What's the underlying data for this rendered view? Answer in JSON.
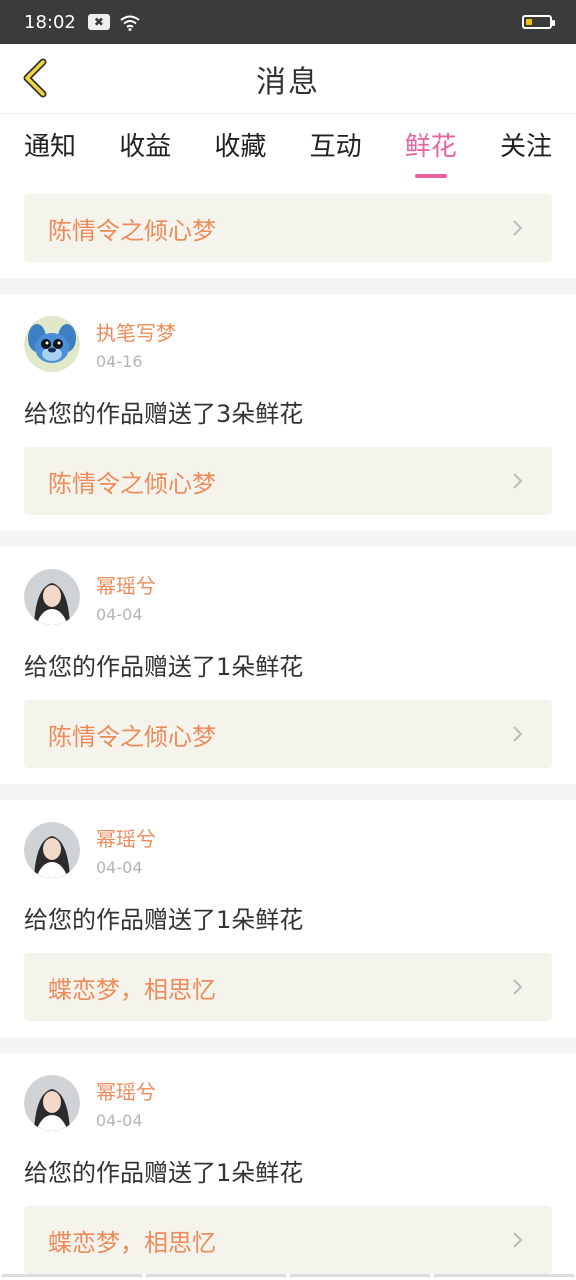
{
  "status_bar": {
    "time": "18:02"
  },
  "header": {
    "title": "消息"
  },
  "tabs": [
    {
      "label": "通知"
    },
    {
      "label": "收益"
    },
    {
      "label": "收藏"
    },
    {
      "label": "互动"
    },
    {
      "label": "鲜花",
      "active": true
    },
    {
      "label": "关注"
    }
  ],
  "first_work": {
    "name": "陈情令之倾心梦"
  },
  "messages": [
    {
      "user": "执笔写梦",
      "date": "04-16",
      "text": "给您的作品赠送了3朵鲜花",
      "work": "陈情令之倾心梦",
      "avatar": "cartoon-avatar"
    },
    {
      "user": "幂瑶兮",
      "date": "04-04",
      "text": "给您的作品赠送了1朵鲜花",
      "work": "陈情令之倾心梦",
      "avatar": "photo-avatar"
    },
    {
      "user": "幂瑶兮",
      "date": "04-04",
      "text": "给您的作品赠送了1朵鲜花",
      "work": "蝶恋梦，相思忆",
      "avatar": "photo-avatar"
    },
    {
      "user": "幂瑶兮",
      "date": "04-04",
      "text": "给您的作品赠送了1朵鲜花",
      "work": "蝶恋梦，相思忆",
      "avatar": "photo-avatar"
    }
  ],
  "colors": {
    "accent": "#e9649a",
    "name_orange": "#ef8b5a",
    "link_bg": "#f5f4ec"
  }
}
